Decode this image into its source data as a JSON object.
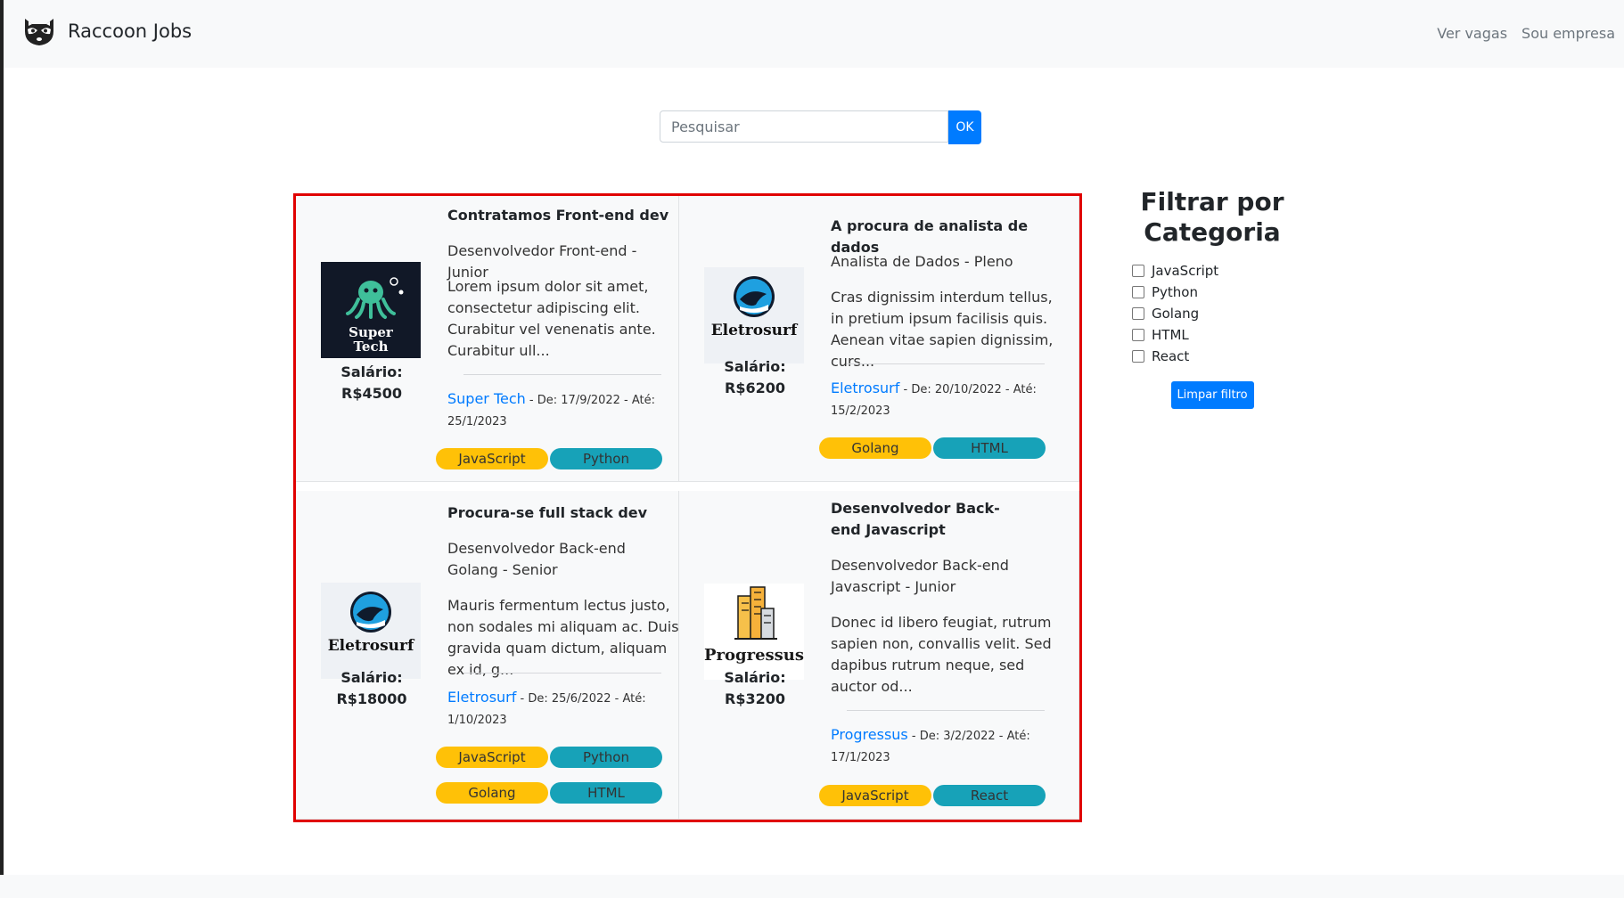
{
  "brand": {
    "name": "Raccoon Jobs"
  },
  "nav": {
    "items": [
      "Ver vagas",
      "Sou empresa"
    ]
  },
  "search": {
    "placeholder": "Pesquisar",
    "button_label": "OK"
  },
  "jobs": [
    {
      "title": "Contratamos Front-end dev",
      "role": "Desenvolvedor Front-end - Junior",
      "description": "Lorem ipsum dolor sit amet, consectetur adipiscing elit. Curabitur vel venenatis ante. Curabitur ull...",
      "salary_label": "Salário:",
      "salary": "R$4500",
      "company": "Super Tech",
      "dates": " - De: 17/9/2022 - Até: 25/1/2023",
      "logo_text": [
        "Super",
        "Tech"
      ],
      "tags": [
        "JavaScript",
        "Python"
      ]
    },
    {
      "title": "A procura de analista de dados",
      "role": "Analista de Dados - Pleno",
      "description": "Cras dignissim interdum tellus, in pretium ipsum facilisis quis. Aenean vitae sapien dignissim, curs...",
      "salary_label": "Salário:",
      "salary": "R$6200",
      "company": "Eletrosurf",
      "dates": " - De: 20/10/2022 - Até: 15/2/2023",
      "logo_text": [
        "Eletrosurf"
      ],
      "tags": [
        "Golang",
        "HTML"
      ]
    },
    {
      "title": "Procura-se full stack dev",
      "role": "Desenvolvedor Back-end Golang - Senior",
      "description": "Mauris fermentum lectus justo, non sodales mi aliquam ac. Duis gravida quam dictum, aliquam ex id, g...",
      "salary_label": "Salário:",
      "salary": "R$18000",
      "company": "Eletrosurf",
      "dates": " - De: 25/6/2022 - Até: 1/10/2023",
      "logo_text": [
        "Eletrosurf"
      ],
      "tags": [
        "JavaScript",
        "Python",
        "Golang",
        "HTML"
      ]
    },
    {
      "title": "Desenvolvedor Back-end Javascript",
      "role": "Desenvolvedor Back-end Javascript - Junior",
      "description": "Donec id libero feugiat, rutrum sapien non, convallis velit. Sed dapibus rutrum neque, sed auctor od...",
      "salary_label": "Salário:",
      "salary": "R$3200",
      "company": "Progressus",
      "dates": " - De: 3/2/2022 - Até: 17/1/2023",
      "logo_text": [
        "Progressus"
      ],
      "tags": [
        "JavaScript",
        "React"
      ]
    }
  ],
  "filter": {
    "title": "Filtrar por Categoria",
    "categories": [
      "JavaScript",
      "Python",
      "Golang",
      "HTML",
      "React"
    ],
    "clear_label": "Limpar filtro"
  },
  "colors": {
    "primary": "#007bff",
    "tag_yellow": "#ffc107",
    "tag_teal": "#17a2b8",
    "frame_red": "#e00000",
    "card_bg": "#f8f9fa"
  }
}
